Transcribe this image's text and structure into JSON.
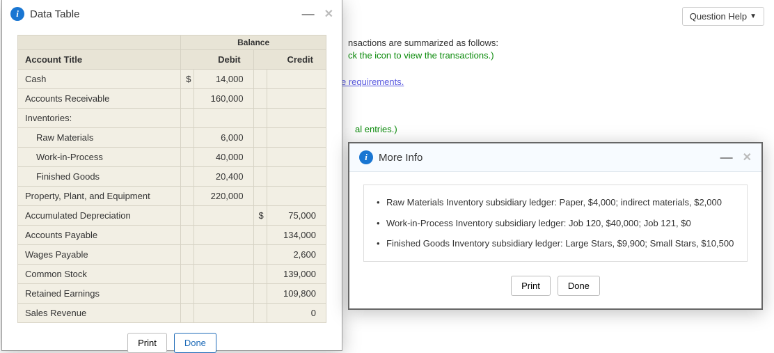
{
  "questionHelp": {
    "label": "Question Help"
  },
  "background": {
    "line1": "nsactions are summarized as follows:",
    "line2": "ck the icon to view the transactions.)",
    "line3": "e requirements.",
    "line4": "al entries.)"
  },
  "dataTable": {
    "title": "Data Table",
    "balanceLabel": "Balance",
    "headers": {
      "account": "Account Title",
      "debit": "Debit",
      "credit": "Credit"
    },
    "rows": [
      {
        "title": "Cash",
        "debitCur": "$",
        "debit": "14,000",
        "creditCur": "",
        "credit": ""
      },
      {
        "title": "Accounts Receivable",
        "debitCur": "",
        "debit": "160,000",
        "creditCur": "",
        "credit": ""
      },
      {
        "title": "Inventories:",
        "debitCur": "",
        "debit": "",
        "creditCur": "",
        "credit": ""
      },
      {
        "title": "Raw Materials",
        "indent": true,
        "debitCur": "",
        "debit": "6,000",
        "creditCur": "",
        "credit": ""
      },
      {
        "title": "Work-in-Process",
        "indent": true,
        "debitCur": "",
        "debit": "40,000",
        "creditCur": "",
        "credit": ""
      },
      {
        "title": "Finished Goods",
        "indent": true,
        "debitCur": "",
        "debit": "20,400",
        "creditCur": "",
        "credit": ""
      },
      {
        "title": "Property, Plant, and Equipment",
        "debitCur": "",
        "debit": "220,000",
        "creditCur": "",
        "credit": ""
      },
      {
        "title": "Accumulated Depreciation",
        "debitCur": "",
        "debit": "",
        "creditCur": "$",
        "credit": "75,000"
      },
      {
        "title": "Accounts Payable",
        "debitCur": "",
        "debit": "",
        "creditCur": "",
        "credit": "134,000"
      },
      {
        "title": "Wages Payable",
        "debitCur": "",
        "debit": "",
        "creditCur": "",
        "credit": "2,600"
      },
      {
        "title": "Common Stock",
        "debitCur": "",
        "debit": "",
        "creditCur": "",
        "credit": "139,000"
      },
      {
        "title": "Retained Earnings",
        "debitCur": "",
        "debit": "",
        "creditCur": "",
        "credit": "109,800"
      },
      {
        "title": "Sales Revenue",
        "debitCur": "",
        "debit": "",
        "creditCur": "",
        "credit": "0"
      }
    ],
    "buttons": {
      "print": "Print",
      "done": "Done"
    }
  },
  "moreInfo": {
    "title": "More Info",
    "items": [
      "Raw Materials Inventory subsidiary ledger: Paper, $4,000; indirect materials, $2,000",
      "Work-in-Process Inventory subsidiary ledger: Job 120, $40,000; Job 121, $0",
      "Finished Goods Inventory subsidiary ledger: Large Stars, $9,900; Small Stars, $10,500"
    ],
    "buttons": {
      "print": "Print",
      "done": "Done"
    }
  }
}
